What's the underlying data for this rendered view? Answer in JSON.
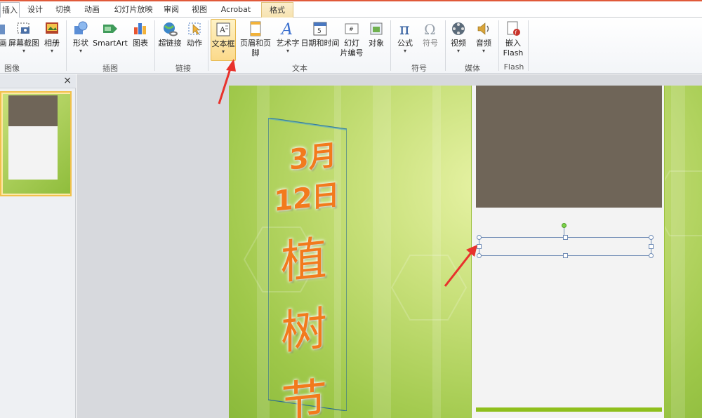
{
  "tabs": [
    {
      "label": "插入",
      "active": true
    },
    {
      "label": "设计"
    },
    {
      "label": "切换"
    },
    {
      "label": "动画"
    },
    {
      "label": "幻灯片放映"
    },
    {
      "label": "审阅"
    },
    {
      "label": "视图"
    },
    {
      "label": "Acrobat"
    },
    {
      "label": "格式",
      "context": true
    }
  ],
  "ribbon": {
    "images": {
      "screenshot_partial": "画",
      "screenshot": "屏幕截图",
      "album": "相册",
      "group_label": "图像"
    },
    "illustrations": {
      "shapes": "形状",
      "smartart": "SmartArt",
      "chart": "图表",
      "group_label": "插图"
    },
    "links": {
      "hyperlink": "超链接",
      "action": "动作",
      "group_label": "链接"
    },
    "text": {
      "textbox": "文本框",
      "header_footer": "页眉和页脚",
      "wordart": "艺术字",
      "datetime": "日期和时间",
      "slide_number_1": "幻灯",
      "slide_number_2": "片编号",
      "object": "对象",
      "group_label": "文本"
    },
    "symbols": {
      "equation": "公式",
      "symbol": "符号",
      "group_label": "符号"
    },
    "media": {
      "video": "视频",
      "audio": "音频",
      "group_label": "媒体"
    },
    "flash": {
      "embed_1": "嵌入",
      "embed_2": "Flash",
      "group_label": "Flash"
    }
  },
  "left_pane": {
    "close": "×"
  },
  "slide": {
    "vertical_text": {
      "month": "3月",
      "day": "12日",
      "char1": "植",
      "char2": "树",
      "char3": "节"
    }
  },
  "colors": {
    "accent_tab": "#e05a3a",
    "title_orange": "#f27a1d",
    "slide_green": "#9fc84a",
    "photo_brown": "#6f6558",
    "arrow_red": "#e8322c"
  }
}
